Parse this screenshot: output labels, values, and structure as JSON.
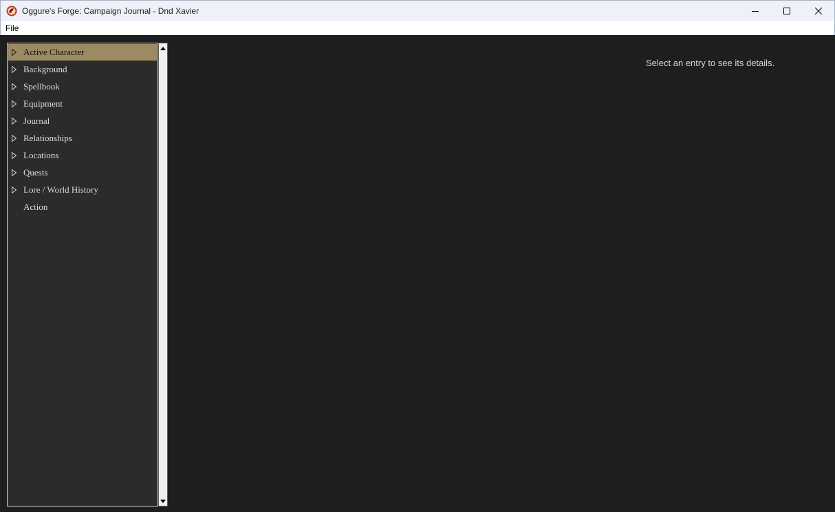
{
  "window": {
    "title": "Oggure's Forge: Campaign Journal - Dnd Xavier",
    "icon": "dragon-emblem-icon",
    "controls": [
      "minimize-icon",
      "maximize-icon",
      "close-icon"
    ]
  },
  "menubar": {
    "file_label": "File"
  },
  "tree": {
    "items": [
      {
        "label": "Active Character",
        "selected": true,
        "has_children": true
      },
      {
        "label": "Background",
        "selected": false,
        "has_children": true
      },
      {
        "label": "Spellbook",
        "selected": false,
        "has_children": true
      },
      {
        "label": "Equipment",
        "selected": false,
        "has_children": true
      },
      {
        "label": "Journal",
        "selected": false,
        "has_children": true
      },
      {
        "label": "Relationships",
        "selected": false,
        "has_children": true
      },
      {
        "label": "Locations",
        "selected": false,
        "has_children": true
      },
      {
        "label": "Quests",
        "selected": false,
        "has_children": true
      },
      {
        "label": "Lore / World History",
        "selected": false,
        "has_children": true
      },
      {
        "label": "Action",
        "selected": false,
        "has_children": false
      }
    ]
  },
  "detail": {
    "hint": "Select an entry to see its details."
  },
  "colors": {
    "background": "#1e1e1e",
    "tree_background": "#2b2b2b",
    "selection": "#9c8a63",
    "text": "#dcdcdc"
  }
}
